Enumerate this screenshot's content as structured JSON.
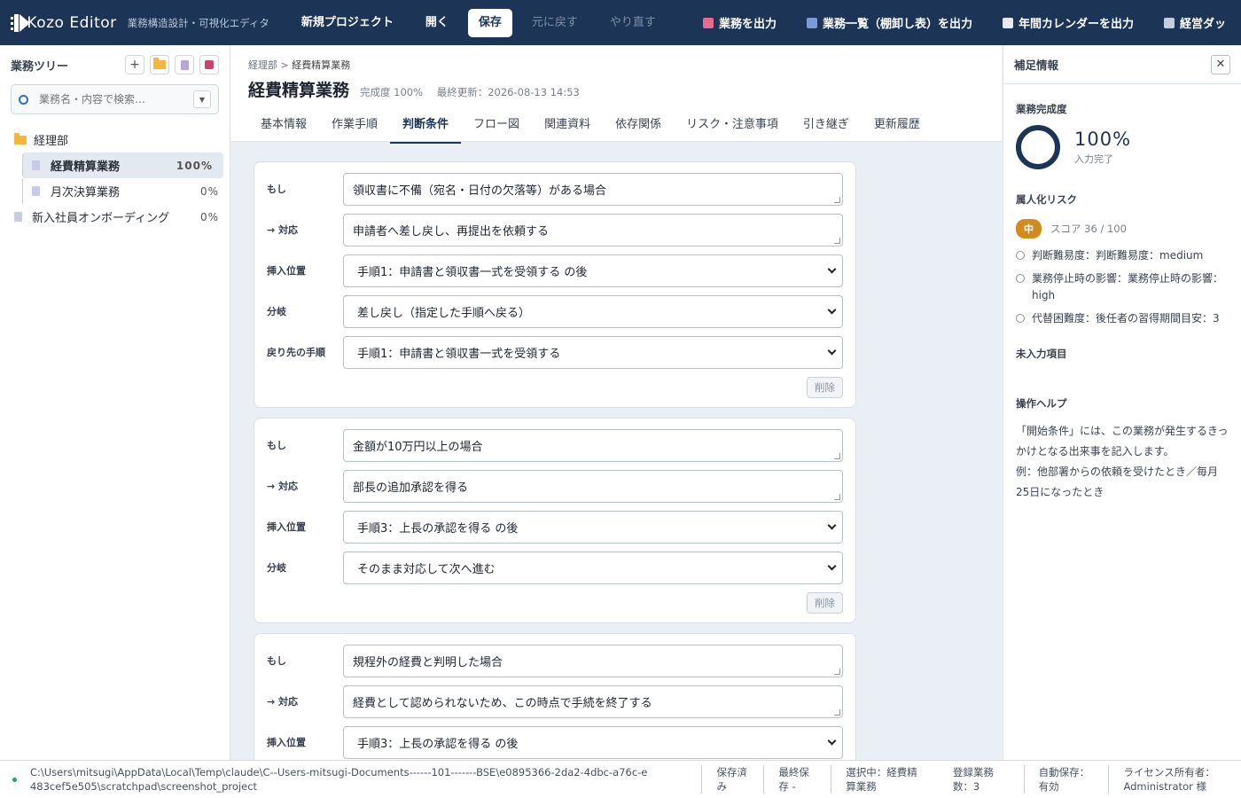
{
  "topbar": {
    "app_name": "Kozo Editor",
    "app_subtitle": "業務構造設計・可視化エディタ",
    "new_project": "新規プロジェクト",
    "open": "開く",
    "save": "保存",
    "undo": "元に戻す",
    "redo": "やり直す",
    "export_task": "業務を出力",
    "export_list": "業務一覧（棚卸し表）を出力",
    "export_calendar": "年間カレンダーを出力",
    "management": "経営ダッ"
  },
  "sidebar": {
    "title": "業務ツリー",
    "search_placeholder": "業務名・内容で検索…",
    "items": [
      {
        "label": "経理部",
        "type": "folder"
      },
      {
        "label": "経費精算業務",
        "pct": "100%",
        "type": "doc",
        "selected": true
      },
      {
        "label": "月次決算業務",
        "pct": "0%",
        "type": "doc"
      },
      {
        "label": "新入社員オンボーディング",
        "pct": "0%",
        "type": "doc"
      }
    ]
  },
  "main": {
    "breadcrumb_root": "経理部",
    "breadcrumb_sep": " > ",
    "breadcrumb_current": "経費精算業務",
    "title": "経費精算業務",
    "completion": "完成度 100%",
    "updated": "最終更新：2026-08-13 14:53",
    "tabs": [
      "基本情報",
      "作業手順",
      "判断条件",
      "フロー図",
      "関連資料",
      "依存関係",
      "リスク・注意事項",
      "引き継ぎ",
      "更新履歴"
    ],
    "active_tab": "判断条件",
    "labels": {
      "if": "もし",
      "action": "→ 対応",
      "insert": "挿入位置",
      "branch": "分岐",
      "return_to": "戻り先の手順",
      "delete": "削除"
    },
    "conditions": [
      {
        "if": "領収書に不備（宛名・日付の欠落等）がある場合",
        "action": "申請者へ差し戻し、再提出を依頼する",
        "insert": "手順1：申請書と領収書一式を受領する の後",
        "branch": "差し戻し（指定した手順へ戻る）",
        "return_to": "手順1：申請書と領収書一式を受領する"
      },
      {
        "if": "金額が10万円以上の場合",
        "action": "部長の追加承認を得る",
        "insert": "手順3：上長の承認を得る の後",
        "branch": "そのまま対応して次へ進む"
      },
      {
        "if": "規程外の経費と判明した場合",
        "action": "経費として認められないため、この時点で手続を終了する",
        "insert": "手順3：上長の承認を得る の後"
      }
    ]
  },
  "right": {
    "title": "補足情報",
    "completion_label": "業務完成度",
    "completion_value": "100%",
    "completion_sub": "入力完了",
    "risk_label": "属人化リスク",
    "risk_badge": "中",
    "risk_score": "スコア 36 / 100",
    "risk_items": [
      "判断難易度：判断難易度：medium",
      "業務停止時の影響：業務停止時の影響：high",
      "代替困難度：後任者の習得期間目安：3"
    ],
    "missing_label": "未入力項目",
    "help_label": "操作ヘルプ",
    "help_text_1": "「開始条件」には、この業務が発生するきっかけとなる出来事を記入します。",
    "help_text_2": "例：他部署からの依頼を受けたとき／毎月25日になったとき"
  },
  "status": {
    "path": "C:\\Users\\mitsugi\\AppData\\Local\\Temp\\claude\\C--Users-mitsugi-Documents------101-------BSE\\e0895366-2da2-4dbc-a76c-e483cef5e505\\scratchpad\\screenshot_project",
    "saved": "保存済み",
    "last_saved": "最終保存 -",
    "selected": "選択中：経費精算業務",
    "count": "登録業務数：3",
    "autosave": "自動保存：有効",
    "license": "ライセンス所有者：Administrator 様"
  },
  "colors": {
    "navy": "#1c3557",
    "risk_medium": "#d58a1e",
    "status_ok": "#2a9d6a"
  }
}
